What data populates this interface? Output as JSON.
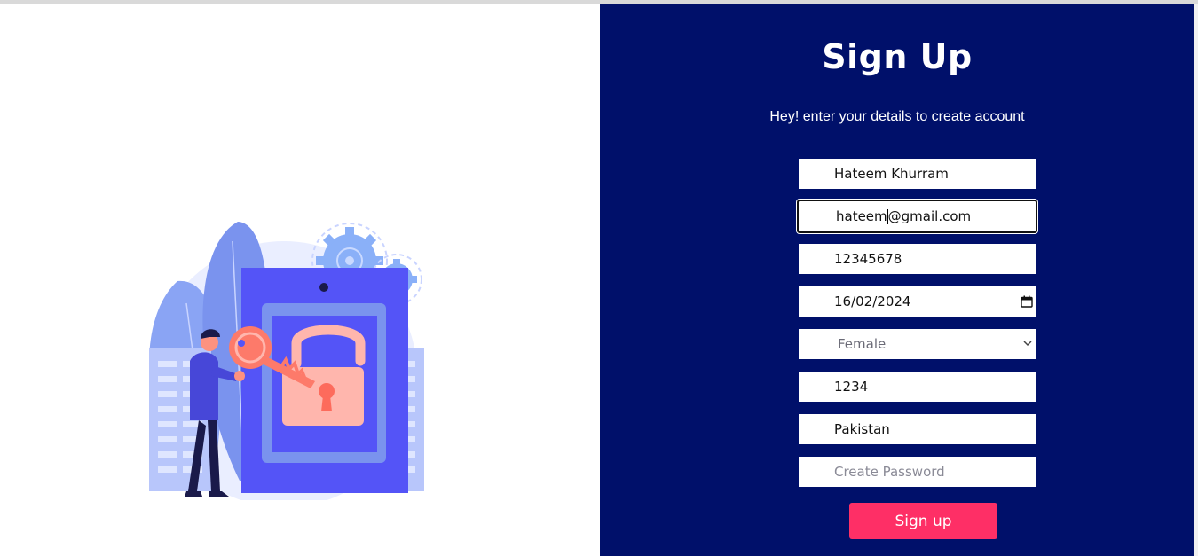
{
  "form": {
    "title": "Sign Up",
    "subtitle": "Hey! enter your details to create account",
    "fields": {
      "name": "Hateem Khurram",
      "email_before_cursor": "hateem",
      "email_after_cursor": "@gmail.com",
      "phone": "12345678",
      "dob": "16/02/2024",
      "gender": "Female",
      "code": "1234",
      "country": "Pakistan",
      "password_placeholder": "Create Password"
    },
    "submit_label": "Sign up"
  },
  "colors": {
    "panel_bg": "#00106a",
    "button_bg": "#fe2f66",
    "illustration_primary": "#5454f7",
    "illustration_accent": "#fd7a6a"
  },
  "icons": [
    "calendar-icon",
    "chevron-down-icon",
    "padlock-icon",
    "key-icon",
    "gear-icon"
  ]
}
